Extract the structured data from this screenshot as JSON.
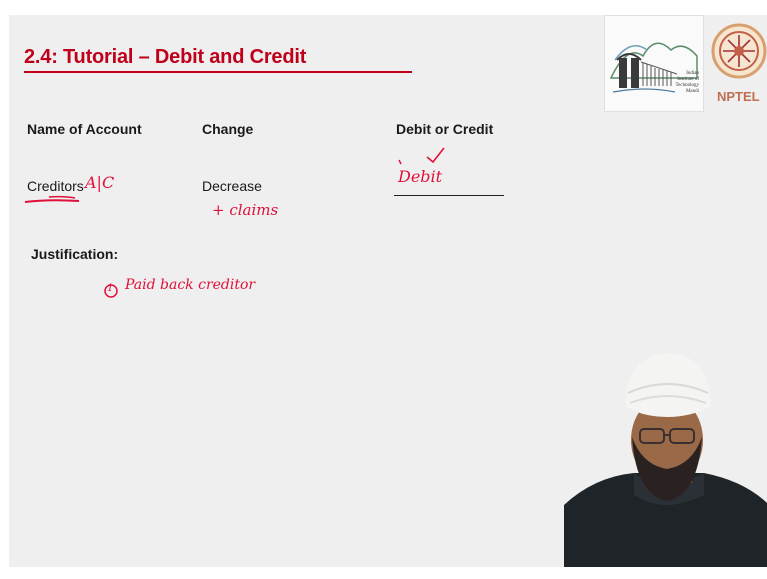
{
  "slide": {
    "title": "2.4: Tutorial – Debit and Credit",
    "headers": {
      "name": "Name of Account",
      "change": "Change",
      "debit_credit": "Debit or Credit"
    },
    "row": {
      "account": "Creditors",
      "change": "Decrease"
    },
    "justification_label": "Justification:"
  },
  "annotations": {
    "account_suffix": "A|C",
    "debit": "Debit",
    "claims": "+ claims",
    "justification_note": "Paid back creditor",
    "item_number": "1"
  },
  "logos": {
    "iit": {
      "line1": "Indian",
      "line2": "Institute of",
      "line3": "Technology",
      "line4": "Mandi"
    },
    "nptel": "NPTEL"
  },
  "colors": {
    "title": "#c0001a",
    "ink": "#e0103a",
    "slide_bg": "#efefef"
  },
  "icons": [
    "iit-mandi-logo-icon",
    "nptel-logo-icon",
    "presenter-video-icon"
  ]
}
